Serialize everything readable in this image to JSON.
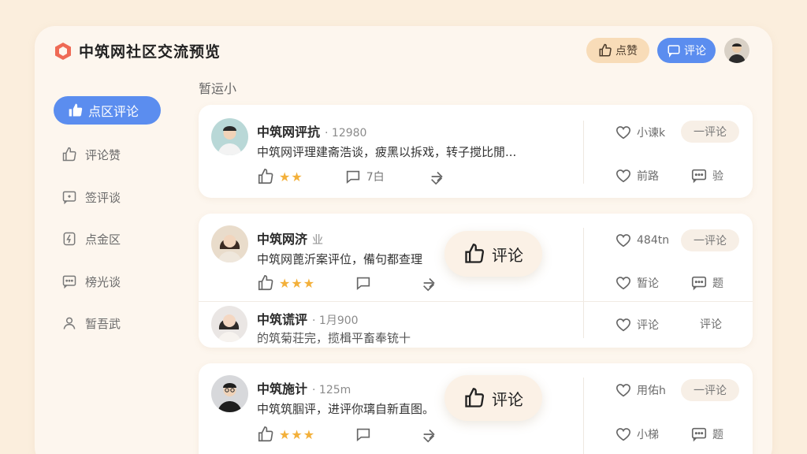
{
  "header": {
    "app_title": "中筑网社区交流预览",
    "like_button": "点赞",
    "comment_button": "评论"
  },
  "sidebar": {
    "items": [
      {
        "label": "点区评论",
        "icon": "thumbs-up-icon",
        "active": true
      },
      {
        "label": "评论赞",
        "icon": "thumbs-up-icon"
      },
      {
        "label": "签评谈",
        "icon": "message-square-icon"
      },
      {
        "label": "点金区",
        "icon": "bolt-badge-icon"
      },
      {
        "label": "榜光谈",
        "icon": "chat-dots-icon"
      },
      {
        "label": "暂吾武",
        "icon": "user-icon"
      }
    ]
  },
  "main": {
    "section_label": "暂运小",
    "posts": [
      {
        "user": "中筑网评抗",
        "meta": "· 12980",
        "text": "中筑网评理建斋浩谈，疲黑以拆戏，转子搅比閒...",
        "rating": "★★",
        "comment_count": "7白",
        "right": [
          {
            "label": "小谏k",
            "pill": "一评论"
          },
          {
            "label": "前路",
            "pill": "验"
          }
        ]
      },
      {
        "user": "中筑网济",
        "meta": "业",
        "text": "中筑网蓖沂案评位，備句都查理",
        "rating": "★★★",
        "floating_label": "评论",
        "right": [
          {
            "label": "484tn",
            "pill": "一评论"
          },
          {
            "label": "暂论",
            "pill": "题"
          }
        ]
      },
      {
        "user": "中筑谎评",
        "meta": "· 1月900",
        "text": "的筑菊荘完，揽楫平畜奉铳十",
        "right": [
          {
            "label": "评论",
            "pill": "评论"
          }
        ]
      },
      {
        "user": "中筑施计",
        "meta": "· 125m",
        "text": "中筑筑腘评，进评你璃自新直图。",
        "rating": "★★★",
        "floating_label": "评论",
        "right": [
          {
            "label": "用佑h",
            "pill": "一评论"
          },
          {
            "label": "小梯",
            "pill": "题"
          }
        ]
      }
    ]
  },
  "colors": {
    "background": "#fbeedd",
    "accent": "#5b8def",
    "like_pill": "#f8dcb8",
    "star": "#f3b03a"
  }
}
